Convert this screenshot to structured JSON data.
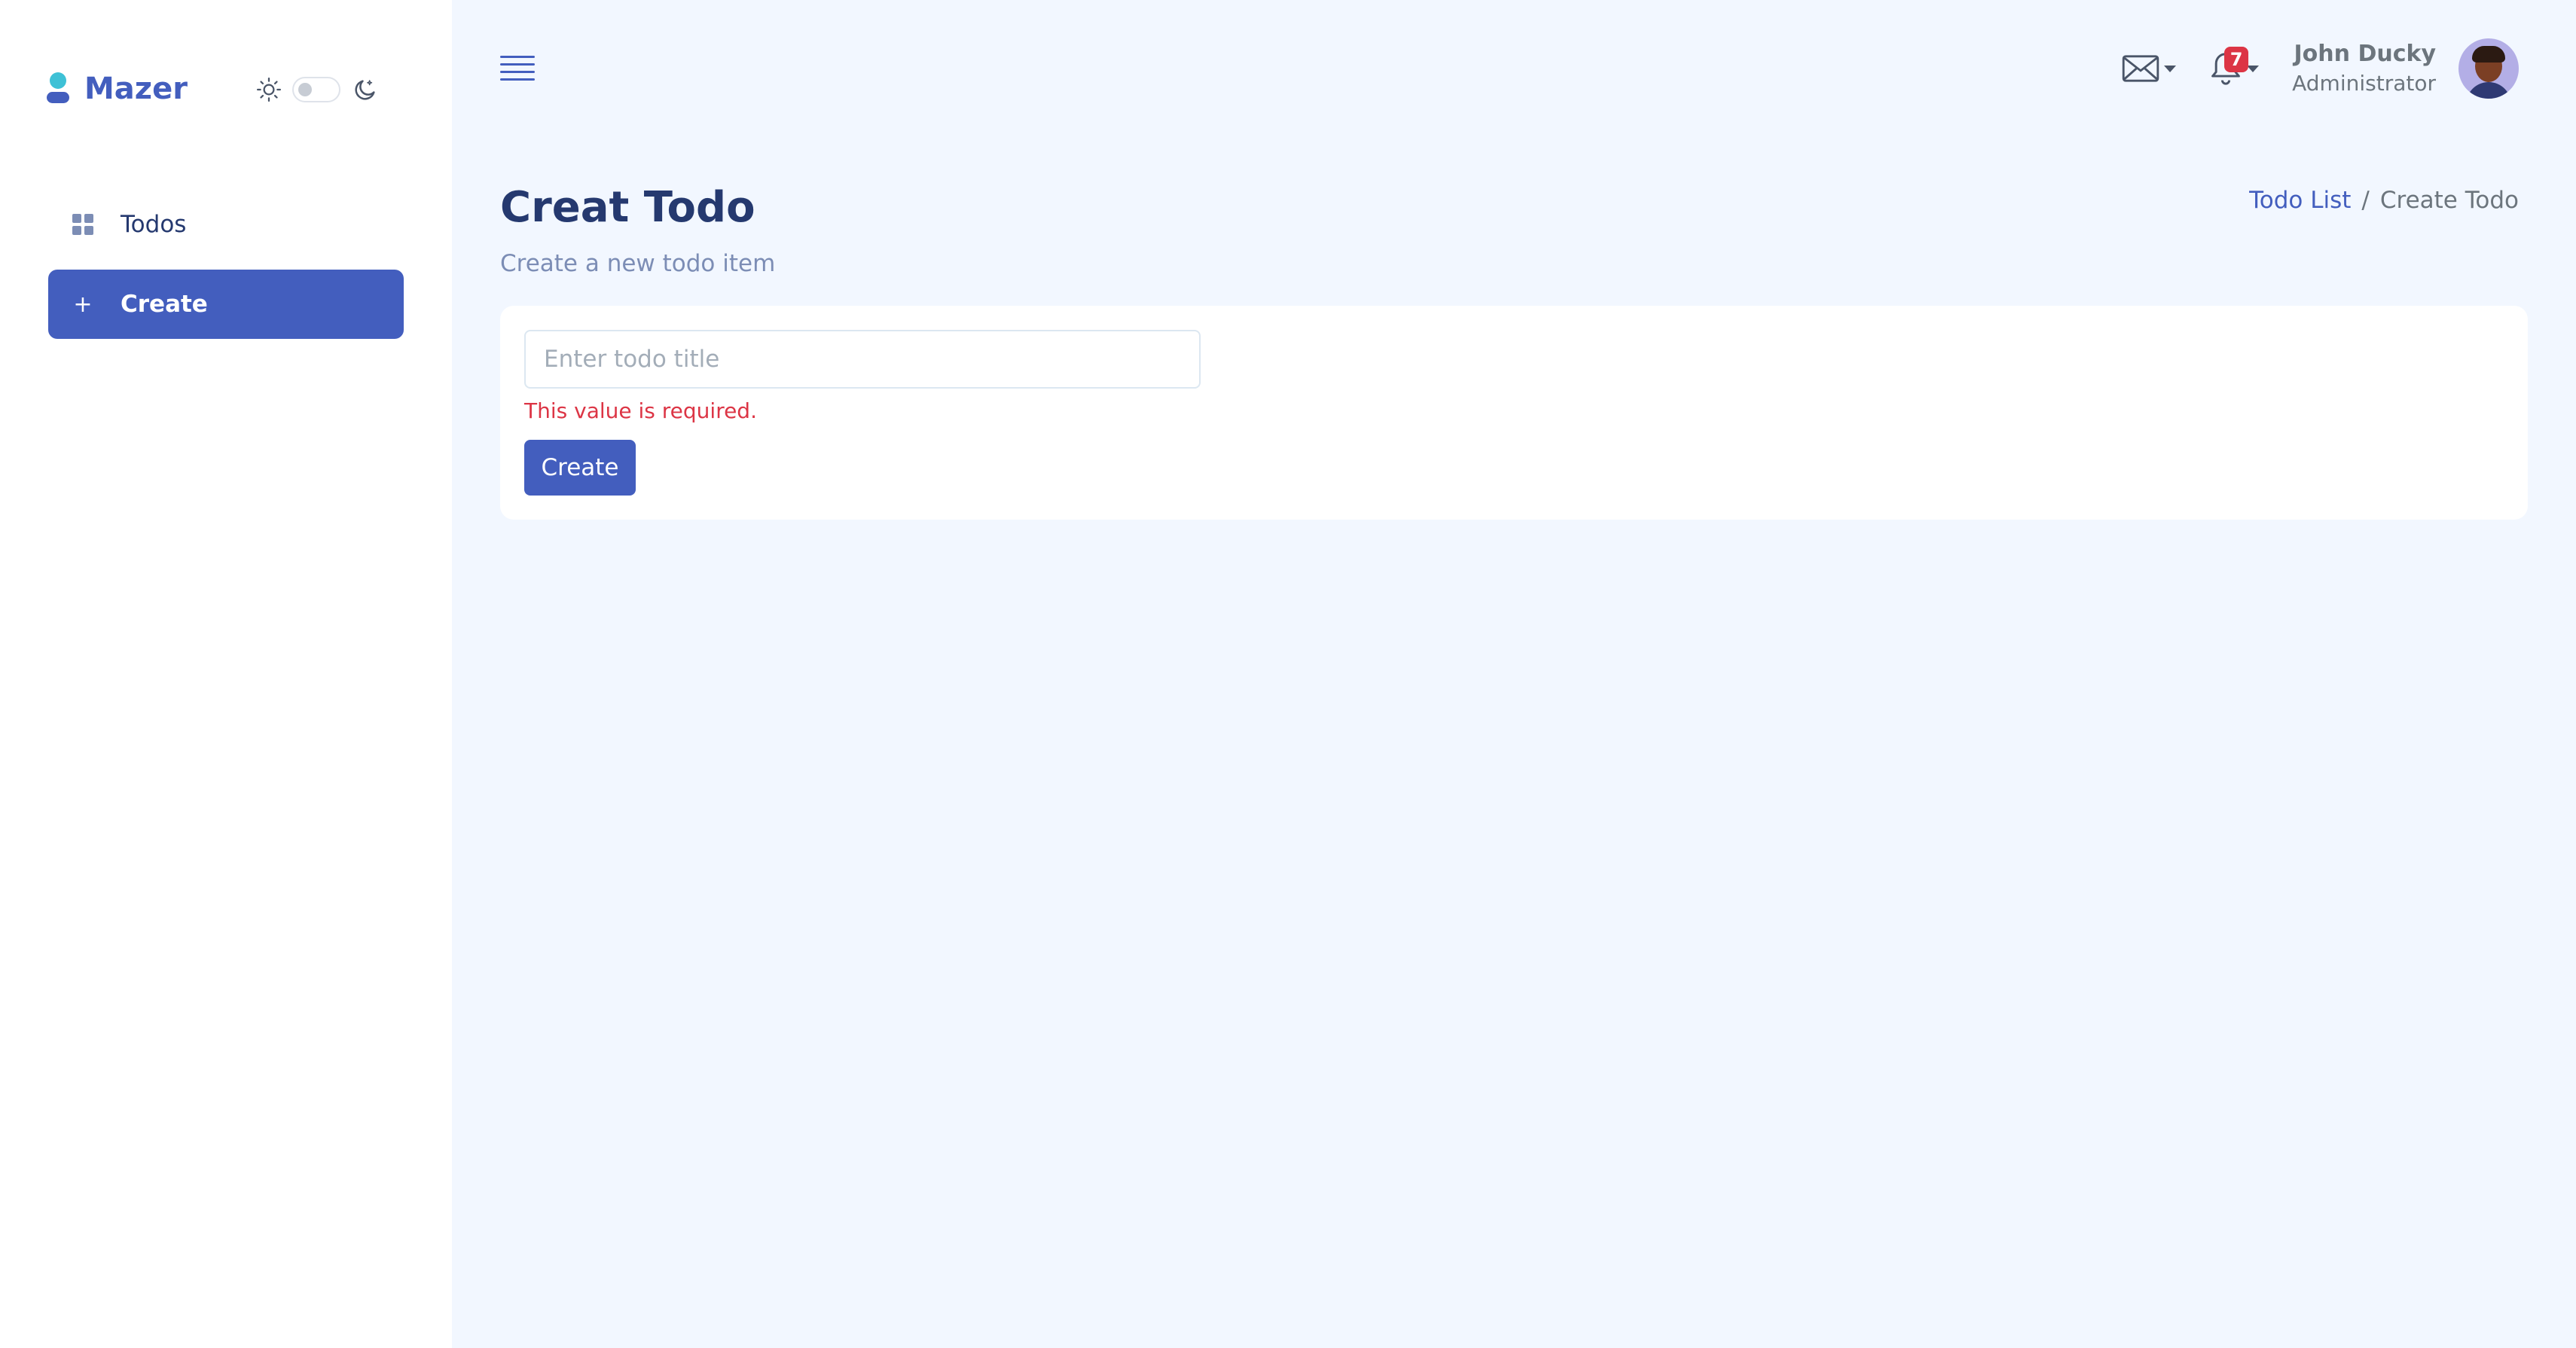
{
  "brand": {
    "name": "Mazer",
    "color": "#435ebe"
  },
  "theme_toggle": {
    "light_icon": "sun-icon",
    "dark_icon": "moon-icon",
    "state": "light"
  },
  "sidebar": {
    "items": [
      {
        "label": "Todos",
        "icon": "grid-icon",
        "active": false
      },
      {
        "label": "Create",
        "icon": "plus-icon",
        "active": true
      }
    ]
  },
  "header": {
    "menu_icon": "hamburger-icon",
    "mail_icon": "envelope-icon",
    "notifications": {
      "icon": "bell-icon",
      "count": "7"
    },
    "user": {
      "name": "John Ducky",
      "role": "Administrator",
      "avatar": "user-avatar"
    }
  },
  "page": {
    "title": "Creat Todo",
    "subtitle": "Create a new todo item"
  },
  "breadcrumb": {
    "link": "Todo List",
    "separator": "/",
    "current": "Create Todo"
  },
  "form": {
    "title_input": {
      "placeholder": "Enter todo title",
      "value": ""
    },
    "error": "This value is required.",
    "submit_label": "Create"
  },
  "colors": {
    "primary": "#435ebe",
    "background": "#f2f7ff",
    "danger": "#dc3545",
    "badge": "#dc3545"
  }
}
